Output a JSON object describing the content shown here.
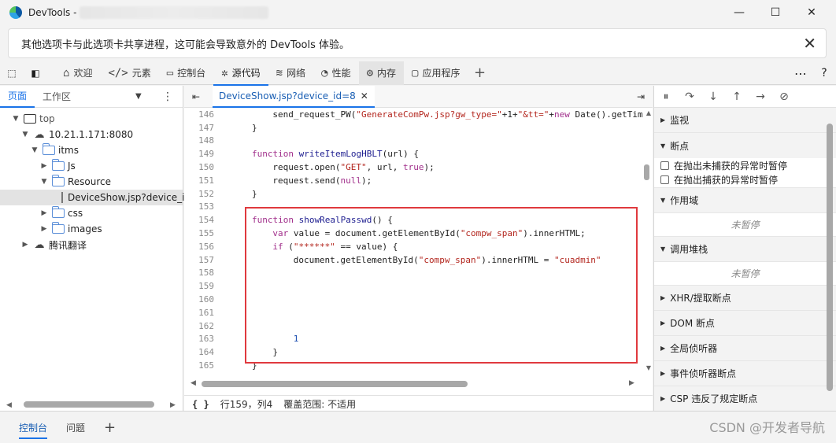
{
  "window": {
    "title": "DevTools -"
  },
  "infobar": {
    "message": "其他选项卡与此选项卡共享进程，这可能会导致意外的 DevTools 体验。"
  },
  "tabs": [
    {
      "label": "欢迎",
      "icon": "⌂"
    },
    {
      "label": "元素",
      "icon": "</>"
    },
    {
      "label": "控制台",
      "icon": "▭"
    },
    {
      "label": "源代码",
      "icon": "✲"
    },
    {
      "label": "网络",
      "icon": "≋"
    },
    {
      "label": "性能",
      "icon": "◔"
    },
    {
      "label": "内存",
      "icon": "⚙"
    },
    {
      "label": "应用程序",
      "icon": "▢"
    }
  ],
  "left_panel": {
    "tabs": [
      "页面",
      "工作区"
    ],
    "tree": {
      "top": "top",
      "host": "10.21.1.171:8080",
      "itms": "itms",
      "js": "Js",
      "resource": "Resource",
      "file": "DeviceShow.jsp?device_id",
      "css": "css",
      "images": "images",
      "translate": "腾讯翻译"
    }
  },
  "editor": {
    "tab_label": "DeviceShow.jsp?device_id=8",
    "status": {
      "position": "行159，列4",
      "coverage": "覆盖范围: 不适用"
    },
    "lines": [
      {
        "n": "146",
        "indent": 4,
        "parts": [
          [
            "t",
            "send_request_PW("
          ],
          [
            "str",
            "\"GenerateComPw.jsp?gw_type=\""
          ],
          [
            "t",
            "+1+"
          ],
          [
            "str",
            "\"&tt=\""
          ],
          [
            "t",
            "+"
          ],
          [
            "kw",
            "new"
          ],
          [
            "t",
            " Date().getTim"
          ]
        ]
      },
      {
        "n": "147",
        "indent": 0,
        "parts": [
          [
            "t",
            "}"
          ]
        ]
      },
      {
        "n": "148",
        "indent": 0,
        "parts": []
      },
      {
        "n": "149",
        "indent": 0,
        "parts": [
          [
            "kw",
            "function"
          ],
          [
            "t",
            " "
          ],
          [
            "fn",
            "writeItemLogHBLT"
          ],
          [
            "t",
            "(url) {"
          ]
        ]
      },
      {
        "n": "150",
        "indent": 4,
        "parts": [
          [
            "t",
            "request.open("
          ],
          [
            "str",
            "\"GET\""
          ],
          [
            "t",
            ", url, "
          ],
          [
            "kw",
            "true"
          ],
          [
            "t",
            ");"
          ]
        ]
      },
      {
        "n": "151",
        "indent": 4,
        "parts": [
          [
            "t",
            "request.send("
          ],
          [
            "kw",
            "null"
          ],
          [
            "t",
            ");"
          ]
        ]
      },
      {
        "n": "152",
        "indent": 0,
        "parts": [
          [
            "t",
            "}"
          ]
        ]
      },
      {
        "n": "153",
        "indent": 0,
        "parts": []
      },
      {
        "n": "154",
        "indent": 0,
        "parts": [
          [
            "kw",
            "function"
          ],
          [
            "t",
            " "
          ],
          [
            "fn",
            "showRealPasswd"
          ],
          [
            "t",
            "() {"
          ]
        ]
      },
      {
        "n": "155",
        "indent": 4,
        "parts": [
          [
            "kw",
            "var"
          ],
          [
            "t",
            " value = document.getElementById("
          ],
          [
            "str",
            "\"compw_span\""
          ],
          [
            "t",
            ").innerHTML;"
          ]
        ]
      },
      {
        "n": "156",
        "indent": 4,
        "parts": [
          [
            "kw",
            "if"
          ],
          [
            "t",
            " ("
          ],
          [
            "str",
            "\"******\""
          ],
          [
            "t",
            " == value) {"
          ]
        ]
      },
      {
        "n": "157",
        "indent": 8,
        "parts": [
          [
            "t",
            "document.getElementById("
          ],
          [
            "str",
            "\"compw_span\""
          ],
          [
            "t",
            ").innerHTML = "
          ],
          [
            "str",
            "\"cuadmin\""
          ]
        ]
      },
      {
        "n": "158",
        "indent": 0,
        "parts": []
      },
      {
        "n": "159",
        "indent": 0,
        "parts": []
      },
      {
        "n": "160",
        "indent": 0,
        "parts": []
      },
      {
        "n": "161",
        "indent": 0,
        "parts": []
      },
      {
        "n": "162",
        "indent": 0,
        "parts": []
      },
      {
        "n": "163",
        "indent": 8,
        "parts": [
          [
            "val",
            "1"
          ]
        ]
      },
      {
        "n": "164",
        "indent": 4,
        "parts": [
          [
            "t",
            "}"
          ]
        ]
      },
      {
        "n": "165",
        "indent": 0,
        "parts": [
          [
            "t",
            "}"
          ]
        ]
      }
    ]
  },
  "right_panel": {
    "monitor": "监视",
    "breakpoints": "断点",
    "pause_uncaught": "在抛出未捕获的异常时暂停",
    "pause_caught": "在抛出捕获的异常时暂停",
    "scope": "作用域",
    "not_paused_1": "未暂停",
    "callstack": "调用堆栈",
    "not_paused_2": "未暂停",
    "xhr": "XHR/提取断点",
    "dom": "DOM 断点",
    "global": "全局侦听器",
    "event": "事件侦听器断点",
    "csp": "CSP 违反了规定断点"
  },
  "bottom": {
    "tabs": [
      "控制台",
      "问题"
    ]
  },
  "watermark": "CSDN @开发者导航"
}
